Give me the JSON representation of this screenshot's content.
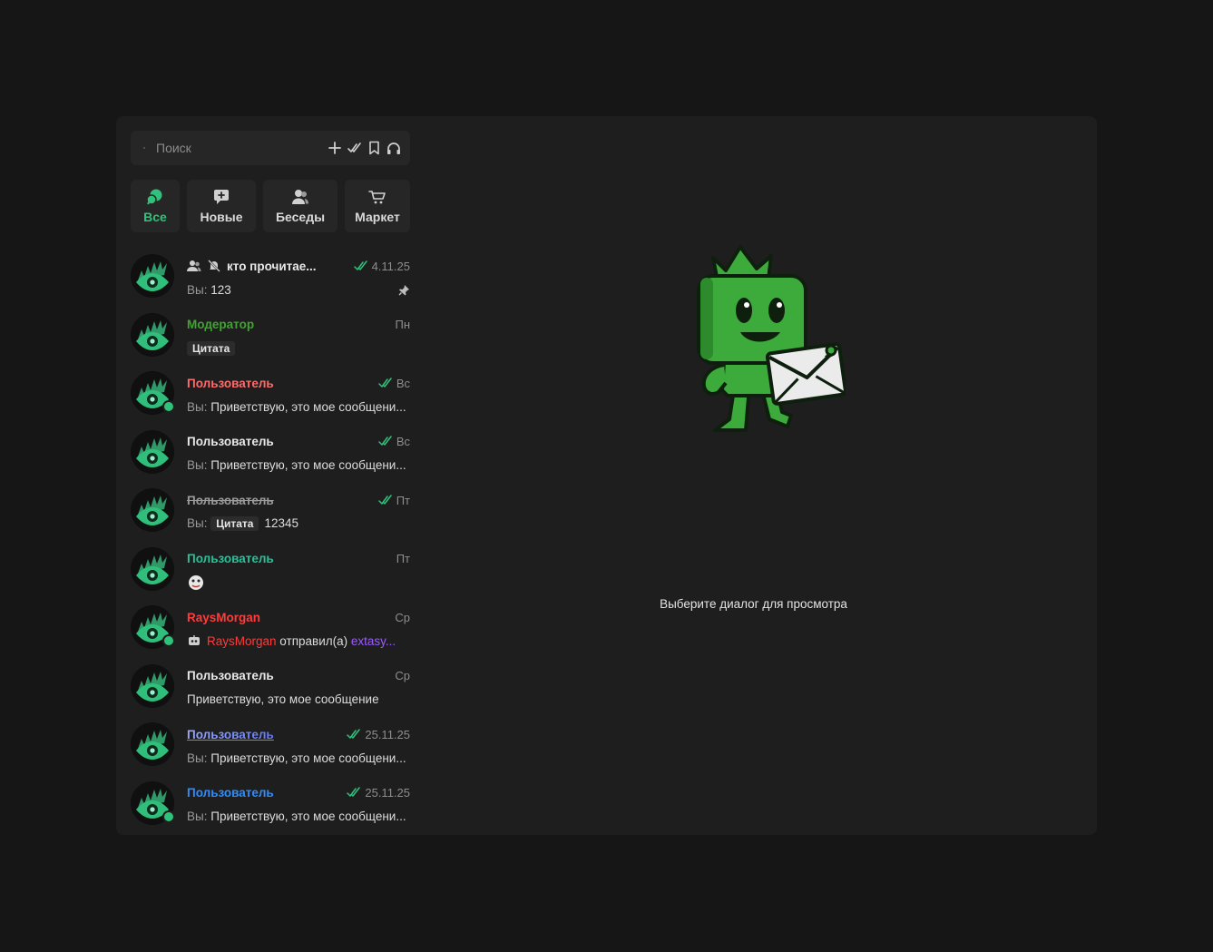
{
  "search": {
    "placeholder": "Поиск"
  },
  "toolbar": {
    "icons": [
      "plus-icon",
      "double-check-icon",
      "bookmark-icon",
      "headphones-icon"
    ]
  },
  "tabs": [
    {
      "label": "Все",
      "icon": "chat-bubbles-icon",
      "active": true
    },
    {
      "label": "Новые",
      "icon": "chat-plus-icon",
      "active": false
    },
    {
      "label": "Беседы",
      "icon": "users-icon",
      "active": false
    },
    {
      "label": "Маркет",
      "icon": "cart-icon",
      "active": false
    }
  ],
  "colors": {
    "accent": "#2fc27a",
    "moderator": "#3fa52f",
    "red_user": "#ff6b6b",
    "raysmorgan": "#ff3b3b",
    "purple": "#9b5cff",
    "blue_user": "#2f8cff",
    "teal_user": "#25c29a"
  },
  "dialogs": [
    {
      "name": "кто прочитае...",
      "date": "4.11.25",
      "you_prefix": "Вы:",
      "preview": "123",
      "read": true,
      "pinned": true,
      "group": true,
      "muted": true
    },
    {
      "name": "Модератор",
      "date": "Пн",
      "quote": "Цитата"
    },
    {
      "name": "Пользователь",
      "date": "Вс",
      "you_prefix": "Вы:",
      "preview": "Приветствую, это мое сообщени...",
      "read": true,
      "online": true
    },
    {
      "name": "Пользователь",
      "date": "Вс",
      "you_prefix": "Вы:",
      "preview": "Приветствую, это мое сообщени...",
      "read": true
    },
    {
      "name": "Пользователь",
      "date": "Пт",
      "you_prefix": "Вы:",
      "quote": "Цитата",
      "preview": "12345",
      "read": true,
      "strikethrough": true
    },
    {
      "name": "Пользователь",
      "date": "Пт",
      "emoji": "sticker-icon"
    },
    {
      "name": "RaysMorgan",
      "date": "Ср",
      "bot_sender": "RaysMorgan",
      "bot_action": "отправил(а)",
      "bot_target": "extasy...",
      "online": true
    },
    {
      "name": "Пользователь",
      "date": "Ср",
      "preview": "Приветствую, это мое сообщение"
    },
    {
      "name": "Пользователь",
      "date": "25.11.25",
      "you_prefix": "Вы:",
      "preview": "Приветствую, это мое сообщени...",
      "read": true,
      "gradient": true
    },
    {
      "name": "Пользователь",
      "date": "25.11.25",
      "you_prefix": "Вы:",
      "preview": "Приветствую, это мое сообщени...",
      "read": true,
      "online": true
    }
  ],
  "empty_state": {
    "text": "Выберите диалог для просмотра"
  }
}
